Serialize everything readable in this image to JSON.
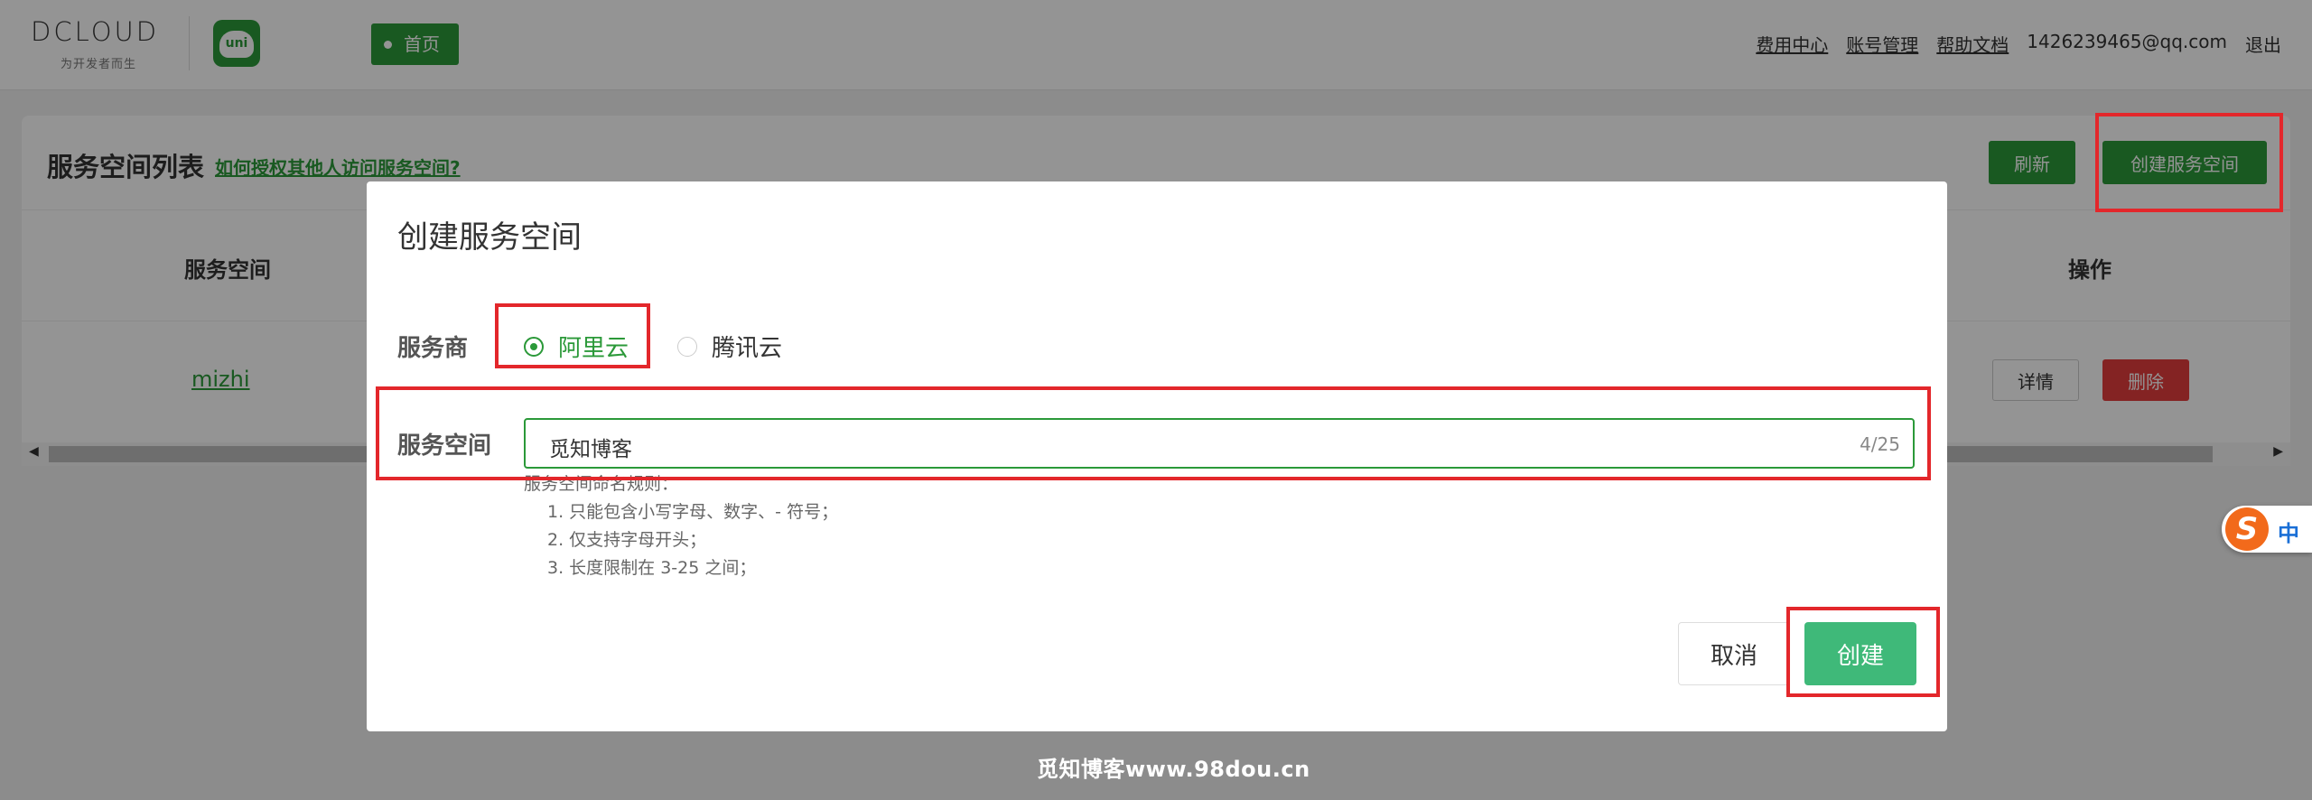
{
  "topbar": {
    "brand_word": "DCLOUD",
    "brand_tagline": "为开发者而生",
    "uni_label": "uni",
    "home_tab": "首页",
    "links": [
      "费用中心",
      "账号管理",
      "帮助文档"
    ],
    "user_email": "1426239465@qq.com",
    "logout": "退出"
  },
  "list": {
    "title": "服务空间列表",
    "help_link": "如何授权其他人访问服务空间?",
    "refresh_button": "刷新",
    "create_button": "创建服务空间",
    "columns": {
      "space": "服务空间",
      "operations": "操作"
    },
    "rows": [
      {
        "name": "mizhi",
        "detail": "详情",
        "delete": "删除"
      }
    ]
  },
  "dialog": {
    "title": "创建服务空间",
    "provider_label": "服务商",
    "providers": [
      {
        "label": "阿里云",
        "checked": true
      },
      {
        "label": "腾讯云",
        "checked": false
      }
    ],
    "space_label": "服务空间",
    "space_value": "觅知博客",
    "char_count": "4/25",
    "rules_title": "服务空间命名规则：",
    "rules": [
      "1. 只能包含小写字母、数字、- 符号；",
      "2. 仅支持字母开头；",
      "3. 长度限制在 3-25 之间；"
    ],
    "cancel": "取消",
    "create": "创建"
  },
  "ime": {
    "icon": "sogou-s-icon",
    "mode": "中"
  },
  "watermark": "觅知博客www.98dou.cn",
  "colors": {
    "brand_green": "#2b9939",
    "button_green": "#3fb979",
    "danger": "#e43d3d",
    "annotation_red": "#e3272b"
  }
}
